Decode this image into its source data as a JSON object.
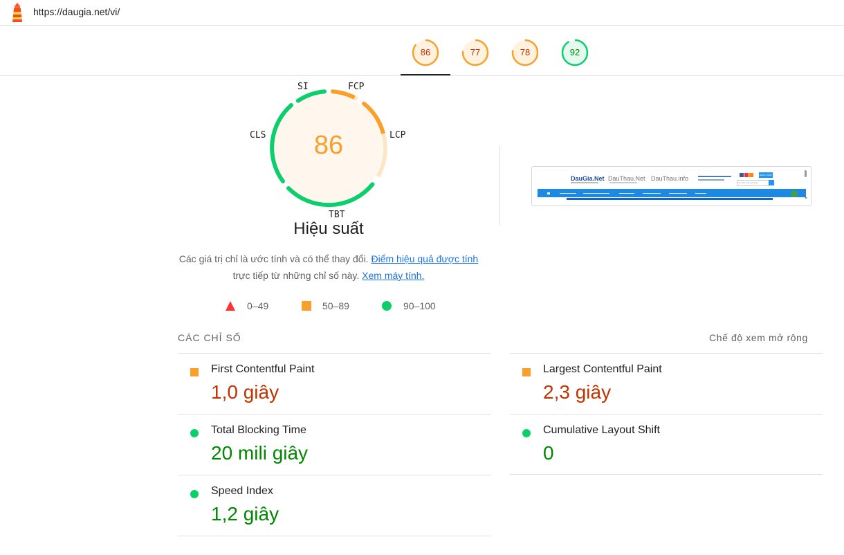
{
  "url_bar": {
    "url": "https://daugia.net/vi/"
  },
  "colors": {
    "average": "#fa9f2a",
    "average_text": "#c33300",
    "pass": "#0cce6b",
    "pass_text": "#008800",
    "fail": "#ff3333"
  },
  "category_tabs": [
    {
      "score": "86",
      "status": "average",
      "selected": true
    },
    {
      "score": "77",
      "status": "average",
      "selected": false
    },
    {
      "score": "78",
      "status": "average",
      "selected": false
    },
    {
      "score": "92",
      "status": "pass",
      "selected": false
    }
  ],
  "gauge": {
    "score": "86",
    "title": "Hiệu suất",
    "metric_labels": {
      "si": "SI",
      "fcp": "FCP",
      "lcp": "LCP",
      "tbt": "TBT",
      "cls": "CLS"
    }
  },
  "description": {
    "text_1": "Các giá trị chỉ là ước tính và có thể thay đổi.",
    "link_1": "Điểm hiệu quả được tính",
    "text_2": "trực tiếp từ những chỉ số này.",
    "link_2": "Xem máy tính."
  },
  "legend": [
    {
      "range": "0–49",
      "icon": "triangle-icon"
    },
    {
      "range": "50–89",
      "icon": "square-icon"
    },
    {
      "range": "90–100",
      "icon": "circle-icon"
    }
  ],
  "metrics_section": {
    "heading": "CÁC CHỈ SỐ",
    "expand_label": "Chế độ xem mở rộng",
    "items": [
      {
        "name": "First Contentful Paint",
        "value": "1,0 giây",
        "status": "average"
      },
      {
        "name": "Largest Contentful Paint",
        "value": "2,3 giây",
        "status": "average"
      },
      {
        "name": "Total Blocking Time",
        "value": "20 mili giây",
        "status": "pass"
      },
      {
        "name": "Cumulative Layout Shift",
        "value": "0",
        "status": "pass"
      },
      {
        "name": "Speed Index",
        "value": "1,2 giây",
        "status": "pass"
      }
    ]
  },
  "screenshot_thumbnail": {
    "brands": [
      "DauGia.Net",
      "DauThau.Net",
      "DauThau.info"
    ],
    "button_label": "ĐĂNG NHẬP",
    "search_placeholder": "Tìm kiếm trên website"
  }
}
